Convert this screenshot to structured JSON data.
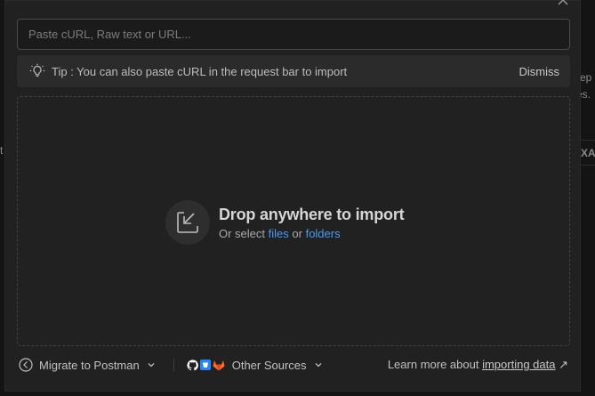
{
  "background": {
    "fragments": [
      "ep",
      "es.",
      "XA",
      "t"
    ]
  },
  "modal": {
    "url_input": {
      "placeholder": "Paste cURL, Raw text or URL...",
      "value": ""
    },
    "tip": {
      "text": "Tip : You can also paste cURL in the request bar to import",
      "dismiss_label": "Dismiss"
    },
    "dropzone": {
      "title": "Drop anywhere to import",
      "sub_prefix": "Or select",
      "files_link": "files",
      "or_word": "or",
      "folders_link": "folders"
    },
    "footer": {
      "migrate_label": "Migrate to Postman",
      "other_sources_label": "Other Sources",
      "learn_prefix": "Learn more about",
      "learn_link": "importing data",
      "learn_arrow": "↗"
    }
  },
  "colors": {
    "accent_link": "#4a9bf0",
    "github": "#ffffff",
    "bitbucket": "#2684ff",
    "gitlab": "#fc6d26"
  }
}
